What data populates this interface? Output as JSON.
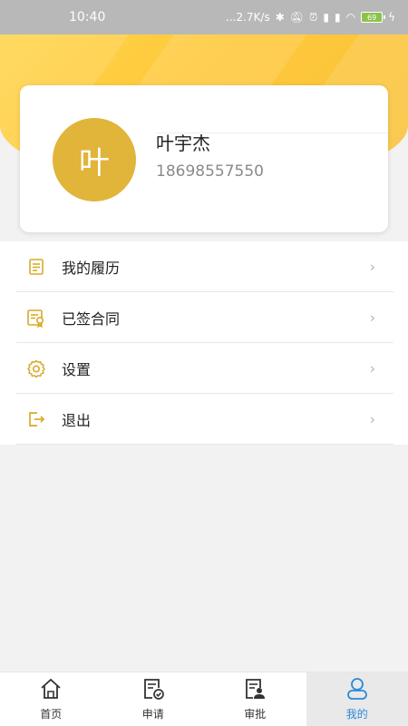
{
  "status_bar": {
    "time": "10:40",
    "network_speed": "...2.7K/s",
    "battery_level": "69"
  },
  "profile": {
    "avatar_char": "叶",
    "name": "叶宇杰",
    "phone": "18698557550"
  },
  "menu": {
    "items": [
      {
        "label": "我的履历",
        "icon": "resume-icon"
      },
      {
        "label": "已签合同",
        "icon": "contract-icon"
      },
      {
        "label": "设置",
        "icon": "gear-icon"
      },
      {
        "label": "退出",
        "icon": "logout-icon"
      }
    ]
  },
  "bottom_nav": {
    "items": [
      {
        "label": "首页",
        "icon": "home-icon"
      },
      {
        "label": "申请",
        "icon": "apply-icon"
      },
      {
        "label": "审批",
        "icon": "approve-icon"
      },
      {
        "label": "我的",
        "icon": "profile-icon",
        "active": true
      }
    ]
  },
  "colors": {
    "accent_yellow": "#f9c13a",
    "avatar": "#e1b43a",
    "icon_gold": "#d9a928",
    "active_blue": "#2b8ad8"
  }
}
